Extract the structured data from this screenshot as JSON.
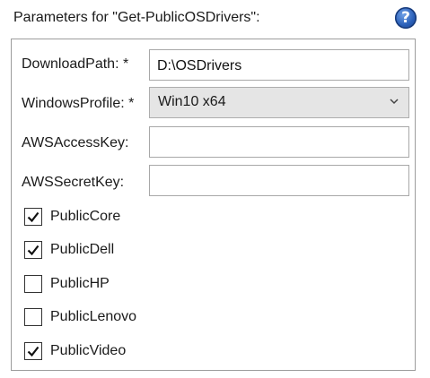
{
  "header": {
    "title": "Parameters for \"Get-PublicOSDrivers\":",
    "help_icon": "help-icon",
    "help_glyph": "?"
  },
  "fields": {
    "download_path": {
      "label": "DownloadPath: *",
      "value": "D:\\OSDrivers"
    },
    "windows_profile": {
      "label": "WindowsProfile: *",
      "value": "Win10 x64",
      "icon": "chevron-down-icon"
    },
    "aws_access_key": {
      "label": "AWSAccessKey:",
      "value": ""
    },
    "aws_secret_key": {
      "label": "AWSSecretKey:",
      "value": ""
    }
  },
  "checkboxes": [
    {
      "label": "PublicCore",
      "checked": true
    },
    {
      "label": "PublicDell",
      "checked": true
    },
    {
      "label": "PublicHP",
      "checked": false
    },
    {
      "label": "PublicLenovo",
      "checked": false
    },
    {
      "label": "PublicVideo",
      "checked": true
    }
  ],
  "colors": {
    "help_button": "#2a5fb8",
    "border": "#9c9c9c",
    "select_background": "#e5e5e5"
  }
}
